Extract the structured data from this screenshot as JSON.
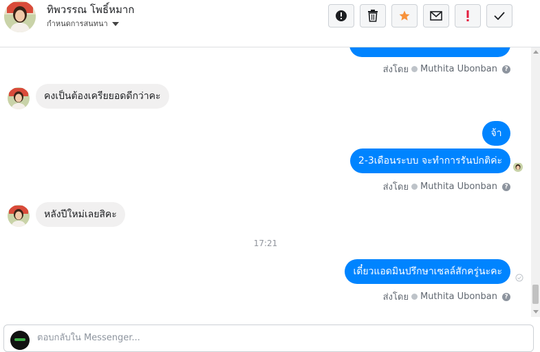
{
  "header": {
    "contact_name": "ทิพวรรณ โพธิ์หมาก",
    "subtitle": "กำหนดการสนทนา",
    "toolbar": [
      {
        "name": "info-button",
        "icon": "exclamation-circle-icon"
      },
      {
        "name": "delete-button",
        "icon": "trash-icon"
      },
      {
        "name": "star-button",
        "icon": "star-icon"
      },
      {
        "name": "mark-unread-button",
        "icon": "envelope-icon"
      },
      {
        "name": "mark-important-button",
        "icon": "exclamation-icon"
      },
      {
        "name": "mark-done-button",
        "icon": "check-icon"
      }
    ]
  },
  "messages": {
    "sent_by_prefix": "ส่งโดย",
    "sender_name": "Muthita Ubonban",
    "incoming_1": "คงเป็นต้องเครียยอดดีกว่าคะ",
    "outgoing_1": "จ้า",
    "outgoing_2": "2-3เดือนระบบ จะทำการรันปกติค่ะ",
    "incoming_2": "หลังปีใหม่เลยสิคะ",
    "time_separator": "17:21",
    "outgoing_3": "เดี๋ยวแอดมินปรึกษาเซลล์สักครู่นะคะ"
  },
  "composer": {
    "placeholder": "ตอบกลับใน Messenger..."
  },
  "colors": {
    "outgoing_bubble": "#0084ff",
    "incoming_bubble": "#f1f0f0",
    "star": "#f7923b",
    "important": "#e41e3f"
  }
}
